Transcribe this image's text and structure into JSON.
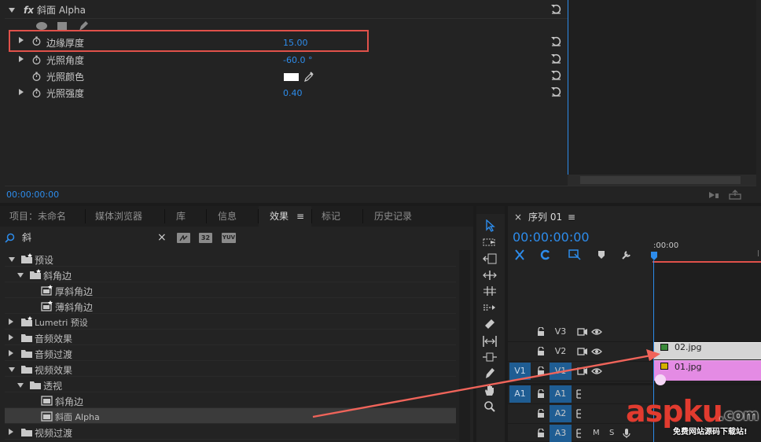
{
  "effect_controls": {
    "fx_label": "fx",
    "effect_name": "斜面 Alpha",
    "properties": [
      {
        "label": "边缘厚度",
        "value": "15.00",
        "expandable": true,
        "highlighted": true
      },
      {
        "label": "光照角度",
        "value": "-60.0 °",
        "expandable": true
      },
      {
        "label": "光照颜色",
        "value": "",
        "expandable": false
      },
      {
        "label": "光照强度",
        "value": "0.40",
        "expandable": true
      }
    ],
    "timecode": "00:00:00:00",
    "light_color": "#ffffff"
  },
  "project_panel": {
    "tabs": [
      "项目：未命名",
      "媒体浏览器",
      "库",
      "信息",
      "效果",
      "标记",
      "历史记录"
    ],
    "active_tab": "效果",
    "menu_glyph": "≡",
    "search_value": "斜",
    "search_clear": "×",
    "filter_badges": [
      "32",
      "YUV"
    ],
    "tree": [
      {
        "label": "预设",
        "level": 0,
        "type": "preset-folder",
        "open": true
      },
      {
        "label": "斜角边",
        "level": 1,
        "type": "preset-folder",
        "open": true
      },
      {
        "label": "厚斜角边",
        "level": 2,
        "type": "preset-item"
      },
      {
        "label": "薄斜角边",
        "level": 2,
        "type": "preset-item"
      },
      {
        "label": "Lumetri 预设",
        "level": 0,
        "type": "preset-folder",
        "open": false
      },
      {
        "label": "音频效果",
        "level": 0,
        "type": "folder",
        "open": false
      },
      {
        "label": "音频过渡",
        "level": 0,
        "type": "folder",
        "open": false
      },
      {
        "label": "视频效果",
        "level": 0,
        "type": "folder",
        "open": true
      },
      {
        "label": "透视",
        "level": 1,
        "type": "folder",
        "open": true
      },
      {
        "label": "斜角边",
        "level": 2,
        "type": "effect"
      },
      {
        "label": "斜面 Alpha",
        "level": 2,
        "type": "effect",
        "selected": true
      },
      {
        "label": "视频过渡",
        "level": 0,
        "type": "folder",
        "open": false
      }
    ]
  },
  "timeline": {
    "close_glyph": "×",
    "sequence_name": "序列 01",
    "menu_glyph": "≡",
    "timecode": "00:00:00:00",
    "ruler_label": ":00:00",
    "tracks": [
      {
        "name": "V3",
        "source": ""
      },
      {
        "name": "V2",
        "source": ""
      },
      {
        "name": "V1",
        "source": "V1"
      },
      {
        "name": "A1",
        "source": "A1"
      },
      {
        "name": "A2",
        "source": ""
      },
      {
        "name": "A3",
        "source": ""
      }
    ],
    "track_buttons": {
      "mute": "M",
      "solo": "S"
    },
    "clips": [
      {
        "name": "02.jpg",
        "track": "V2",
        "color": "#d5d5d5"
      },
      {
        "name": "01.jpg",
        "track": "V1",
        "color": "#e48be4"
      }
    ]
  },
  "watermark": {
    "brand": "aspku",
    "tld": ".com",
    "tagline": "免费网站源码下载站!"
  },
  "colors": {
    "accent": "#2d8ceb",
    "highlight_box": "#e0514a",
    "arrow": "#f0645a",
    "playhead": "#2d8ceb"
  }
}
